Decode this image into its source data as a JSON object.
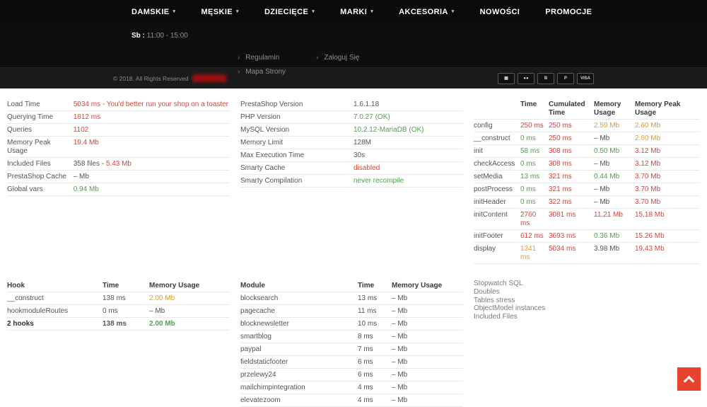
{
  "nav": {
    "items": [
      {
        "label": "DAMSKIE",
        "chevron": true
      },
      {
        "label": "MĘSKIE",
        "chevron": true
      },
      {
        "label": "DZIECIĘCE",
        "chevron": true
      },
      {
        "label": "MARKI",
        "chevron": true
      },
      {
        "label": "AKCESORIA",
        "chevron": true
      },
      {
        "label": "NOWOŚCI",
        "chevron": false
      },
      {
        "label": "PROMOCJE",
        "chevron": false
      }
    ]
  },
  "subheader": {
    "hours_label": "Sb :",
    "hours_value": "11:00 - 15:00",
    "links": [
      {
        "label": "Regulamin"
      },
      {
        "label": "Mapa Strony"
      },
      {
        "label": "Zaloguj Się"
      }
    ]
  },
  "footer": {
    "copyright": "© 2018. All Rights Reserved",
    "payments": [
      {
        "name": "card",
        "glyph": "▦"
      },
      {
        "name": "mastercard",
        "glyph": "●●"
      },
      {
        "name": "bitcoin",
        "glyph": "B"
      },
      {
        "name": "paypal",
        "glyph": "P"
      },
      {
        "name": "visa",
        "glyph": "VISA"
      }
    ]
  },
  "colors": {
    "accent_red": "#e8432e",
    "status_red": "#e2403a",
    "status_green": "#4fa14f",
    "status_orange": "#e79b2f"
  },
  "profiler": {
    "load": {
      "rows": [
        {
          "label": "Load Time",
          "parts": [
            [
              "5034 ms - You'd better run your shop on a toaster",
              "red"
            ]
          ]
        },
        {
          "label": "Querying Time",
          "parts": [
            [
              "1812 ms",
              "red"
            ]
          ]
        },
        {
          "label": "Queries",
          "parts": [
            [
              "1102",
              "red"
            ]
          ]
        },
        {
          "label": "Memory Peak Usage",
          "parts": [
            [
              "19.4 Mb",
              "red"
            ]
          ]
        },
        {
          "label": "Included Files",
          "parts": [
            [
              "358 files - ",
              "plain"
            ],
            [
              "5.43 Mb",
              "red"
            ]
          ]
        },
        {
          "label": "PrestaShop Cache",
          "parts": [
            [
              "– Mb",
              "plain"
            ]
          ]
        },
        {
          "label": "Global vars",
          "parts": [
            [
              "0.94 Mb",
              "green"
            ]
          ]
        }
      ]
    },
    "server": {
      "rows": [
        {
          "label": "PrestaShop Version",
          "parts": [
            [
              "1.6.1.18",
              "plain"
            ]
          ]
        },
        {
          "label": "PHP Version",
          "parts": [
            [
              "7.0.27 (OK)",
              "green"
            ]
          ]
        },
        {
          "label": "MySQL Version",
          "parts": [
            [
              "10.2.12-MariaDB (OK)",
              "green"
            ]
          ]
        },
        {
          "label": "Memory Limit",
          "parts": [
            [
              "128M",
              "plain"
            ]
          ]
        },
        {
          "label": "Max Execution Time",
          "parts": [
            [
              "30s",
              "plain"
            ]
          ]
        },
        {
          "label": "Smarty Cache",
          "parts": [
            [
              "disabled",
              "red"
            ]
          ]
        },
        {
          "label": "Smarty Compilation",
          "parts": [
            [
              "never recompile",
              "green"
            ]
          ]
        }
      ]
    },
    "timing": {
      "headers": [
        "",
        "Time",
        "Cumulated Time",
        "Memory Usage",
        "Memory Peak Usage"
      ],
      "rows": [
        {
          "label": "config",
          "cells": [
            [
              "250 ms",
              "red"
            ],
            [
              "250 ms",
              "red"
            ],
            [
              "2.59 Mb",
              "orange"
            ],
            [
              "2.60 Mb",
              "orange"
            ]
          ]
        },
        {
          "label": "__construct",
          "cells": [
            [
              "0 ms",
              "green"
            ],
            [
              "250 ms",
              "red"
            ],
            [
              "– Mb",
              "plain"
            ],
            [
              "2.60 Mb",
              "orange"
            ]
          ]
        },
        {
          "label": "init",
          "cells": [
            [
              "58 ms",
              "green"
            ],
            [
              "308 ms",
              "red"
            ],
            [
              "0.50 Mb",
              "green"
            ],
            [
              "3.12 Mb",
              "red"
            ]
          ]
        },
        {
          "label": "checkAccess",
          "cells": [
            [
              "0 ms",
              "green"
            ],
            [
              "308 ms",
              "red"
            ],
            [
              "– Mb",
              "plain"
            ],
            [
              "3.12 Mb",
              "red"
            ]
          ]
        },
        {
          "label": "setMedia",
          "cells": [
            [
              "13 ms",
              "green"
            ],
            [
              "321 ms",
              "red"
            ],
            [
              "0.44 Mb",
              "green"
            ],
            [
              "3.70 Mb",
              "red"
            ]
          ]
        },
        {
          "label": "postProcess",
          "cells": [
            [
              "0 ms",
              "green"
            ],
            [
              "321 ms",
              "red"
            ],
            [
              "– Mb",
              "plain"
            ],
            [
              "3.70 Mb",
              "red"
            ]
          ]
        },
        {
          "label": "initHeader",
          "cells": [
            [
              "0 ms",
              "green"
            ],
            [
              "322 ms",
              "red"
            ],
            [
              "– Mb",
              "plain"
            ],
            [
              "3.70 Mb",
              "red"
            ]
          ]
        },
        {
          "label": "initContent",
          "cells": [
            [
              "2760 ms",
              "red"
            ],
            [
              "3081 ms",
              "red"
            ],
            [
              "11.21 Mb",
              "red"
            ],
            [
              "15.18 Mb",
              "red"
            ]
          ]
        },
        {
          "label": "initFooter",
          "cells": [
            [
              "612 ms",
              "red"
            ],
            [
              "3693 ms",
              "red"
            ],
            [
              "0.36 Mb",
              "green"
            ],
            [
              "15.26 Mb",
              "red"
            ]
          ]
        },
        {
          "label": "display",
          "cells": [
            [
              "1341 ms",
              "orange"
            ],
            [
              "5034 ms",
              "red"
            ],
            [
              "3.98 Mb",
              "plain"
            ],
            [
              "19.43 Mb",
              "red"
            ]
          ]
        }
      ]
    },
    "hooks": {
      "headers": [
        "Hook",
        "Time",
        "Memory Usage"
      ],
      "rows": [
        {
          "label": "__construct",
          "bold": false,
          "cells": [
            [
              "138 ms",
              "plain"
            ],
            [
              "2.00 Mb",
              "orange"
            ]
          ]
        },
        {
          "label": "hookmoduleRoutes",
          "bold": false,
          "cells": [
            [
              "0 ms",
              "plain"
            ],
            [
              "– Mb",
              "plain"
            ]
          ]
        },
        {
          "label": "2 hooks",
          "bold": true,
          "cells": [
            [
              "138 ms",
              "plain"
            ],
            [
              "2.00 Mb",
              "green"
            ]
          ]
        }
      ]
    },
    "modules": {
      "headers": [
        "Module",
        "Time",
        "Memory Usage"
      ],
      "rows": [
        {
          "label": "blocksearch",
          "bold": false,
          "cells": [
            [
              "13 ms",
              "plain"
            ],
            [
              "– Mb",
              "plain"
            ]
          ]
        },
        {
          "label": "pagecache",
          "bold": false,
          "cells": [
            [
              "11 ms",
              "plain"
            ],
            [
              "– Mb",
              "plain"
            ]
          ]
        },
        {
          "label": "blocknewsletter",
          "bold": false,
          "cells": [
            [
              "10 ms",
              "plain"
            ],
            [
              "– Mb",
              "plain"
            ]
          ]
        },
        {
          "label": "smartblog",
          "bold": false,
          "cells": [
            [
              "8 ms",
              "plain"
            ],
            [
              "– Mb",
              "plain"
            ]
          ]
        },
        {
          "label": "paypal",
          "bold": false,
          "cells": [
            [
              "7 ms",
              "plain"
            ],
            [
              "– Mb",
              "plain"
            ]
          ]
        },
        {
          "label": "fieldstaticfooter",
          "bold": false,
          "cells": [
            [
              "6 ms",
              "plain"
            ],
            [
              "– Mb",
              "plain"
            ]
          ]
        },
        {
          "label": "przelewy24",
          "bold": false,
          "cells": [
            [
              "6 ms",
              "plain"
            ],
            [
              "– Mb",
              "plain"
            ]
          ]
        },
        {
          "label": "mailchimpintegration",
          "bold": false,
          "cells": [
            [
              "4 ms",
              "plain"
            ],
            [
              "– Mb",
              "plain"
            ]
          ]
        },
        {
          "label": "elevatezoom",
          "bold": false,
          "cells": [
            [
              "4 ms",
              "plain"
            ],
            [
              "– Mb",
              "plain"
            ]
          ]
        }
      ]
    },
    "quick_links": [
      "Stopwatch SQL",
      "Doubles",
      "Tables stress",
      "ObjectModel instances",
      "Included Files"
    ]
  }
}
